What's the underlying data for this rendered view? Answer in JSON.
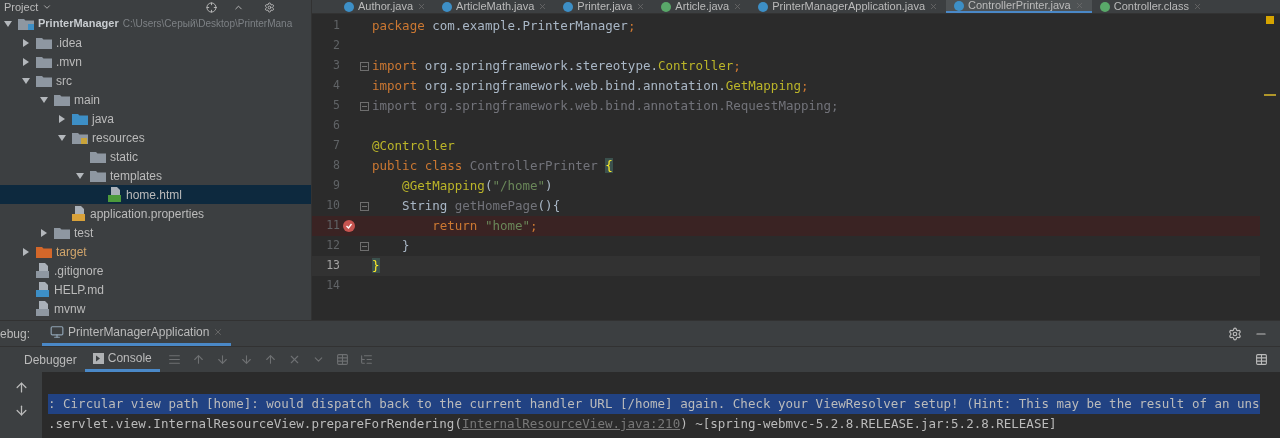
{
  "project_panel": {
    "title": "Project",
    "tree": [
      {
        "label": "PrinterManager",
        "path": "C:\\Users\\Серый\\Desktop\\PrinterMana",
        "kind": "module",
        "expanded": true,
        "selected": false,
        "children": [
          {
            "label": ".idea",
            "kind": "folder",
            "expanded": false,
            "selected": false
          },
          {
            "label": ".mvn",
            "kind": "folder",
            "expanded": false,
            "selected": false
          },
          {
            "label": "src",
            "kind": "folder",
            "expanded": true,
            "selected": false,
            "children": [
              {
                "label": "main",
                "kind": "folder",
                "expanded": true,
                "selected": false,
                "children": [
                  {
                    "label": "java",
                    "kind": "source",
                    "expanded": false,
                    "selected": false
                  },
                  {
                    "label": "resources",
                    "kind": "resources",
                    "expanded": true,
                    "selected": false,
                    "children": [
                      {
                        "label": "static",
                        "kind": "folder",
                        "selected": false
                      },
                      {
                        "label": "templates",
                        "kind": "folder",
                        "expanded": true,
                        "selected": false,
                        "children": [
                          {
                            "label": "home.html",
                            "kind": "html",
                            "selected": true
                          }
                        ]
                      }
                    ]
                  },
                  {
                    "label": "application.properties",
                    "kind": "properties",
                    "selected": false
                  }
                ]
              },
              {
                "label": "test",
                "kind": "folder",
                "expanded": false,
                "selected": false
              }
            ]
          },
          {
            "label": "target",
            "kind": "excluded",
            "expanded": false,
            "selected": false
          },
          {
            "label": ".gitignore",
            "kind": "ignore",
            "selected": false
          },
          {
            "label": "HELP.md",
            "kind": "markdown",
            "selected": false
          },
          {
            "label": "mvnw",
            "kind": "script",
            "selected": false
          }
        ]
      }
    ]
  },
  "editor_tabs": [
    {
      "label": "Author.java",
      "kind": "class",
      "selected": false
    },
    {
      "label": "ArticleMath.java",
      "kind": "class",
      "selected": false
    },
    {
      "label": "Printer.java",
      "kind": "class",
      "selected": false
    },
    {
      "label": "Article.java",
      "kind": "interface",
      "selected": false
    },
    {
      "label": "PrinterManagerApplication.java",
      "kind": "class",
      "selected": false
    },
    {
      "label": "ControllerPrinter.java",
      "kind": "class",
      "selected": true
    },
    {
      "label": "Controller.class",
      "kind": "interface",
      "selected": false
    }
  ],
  "code": {
    "lines": [
      {
        "number": "1",
        "fold": false,
        "breakpoint": false,
        "current": false,
        "tokens": [
          {
            "text": "package",
            "kind": "keyword"
          },
          {
            "text": " com.example.PrinterManager",
            "kind": "plain"
          },
          {
            "text": ";",
            "kind": "keyword"
          }
        ]
      },
      {
        "number": "2",
        "fold": false,
        "breakpoint": false,
        "current": false
      },
      {
        "number": "3",
        "fold": true,
        "breakpoint": false,
        "current": false,
        "tokens": [
          {
            "text": "import",
            "kind": "keyword"
          },
          {
            "text": " org.springframework.stereotype.",
            "kind": "plain"
          },
          {
            "text": "Controller",
            "kind": "annotation"
          },
          {
            "text": ";",
            "kind": "keyword"
          }
        ]
      },
      {
        "number": "4",
        "fold": false,
        "breakpoint": false,
        "current": false,
        "tokens": [
          {
            "text": "import",
            "kind": "keyword"
          },
          {
            "text": " org.springframework.web.bind.annotation.",
            "kind": "plain"
          },
          {
            "text": "GetMapping",
            "kind": "annotation"
          },
          {
            "text": ";",
            "kind": "keyword"
          }
        ]
      },
      {
        "number": "5",
        "fold": true,
        "breakpoint": false,
        "current": false,
        "tokens": [
          {
            "text": "import org.springframework.web.bind.annotation.RequestMapping;",
            "kind": "unused"
          }
        ]
      },
      {
        "number": "6",
        "fold": false,
        "breakpoint": false,
        "current": false
      },
      {
        "number": "7",
        "fold": false,
        "breakpoint": false,
        "current": false,
        "tokens": [
          {
            "text": "@Controller",
            "kind": "annotation"
          }
        ]
      },
      {
        "number": "8",
        "fold": false,
        "breakpoint": false,
        "current": false,
        "tokens": [
          {
            "text": "public class",
            "kind": "keyword"
          },
          {
            "text": " ControllerPrinter ",
            "kind": "unused"
          },
          {
            "text": "{",
            "kind": "brace"
          }
        ]
      },
      {
        "number": "9",
        "fold": false,
        "breakpoint": false,
        "current": false,
        "tokens": [
          {
            "text": "    @GetMapping",
            "kind": "annotation"
          },
          {
            "text": "(",
            "kind": "plain"
          },
          {
            "text": "\"/home\"",
            "kind": "string"
          },
          {
            "text": ")",
            "kind": "plain"
          }
        ]
      },
      {
        "number": "10",
        "fold": true,
        "breakpoint": false,
        "current": false,
        "tokens": [
          {
            "text": "    String",
            "kind": "plain"
          },
          {
            "text": " getHomePage",
            "kind": "unused"
          },
          {
            "text": "(){",
            "kind": "plain"
          }
        ]
      },
      {
        "number": "11",
        "fold": false,
        "breakpoint": true,
        "current": false,
        "tokens": [
          {
            "text": "        return",
            "kind": "keyword"
          },
          {
            "text": " \"home\"",
            "kind": "string"
          },
          {
            "text": ";",
            "kind": "keyword"
          }
        ]
      },
      {
        "number": "12",
        "fold": true,
        "breakpoint": false,
        "current": false,
        "tokens": [
          {
            "text": "    }",
            "kind": "plain"
          }
        ]
      },
      {
        "number": "13",
        "fold": false,
        "breakpoint": false,
        "current": true,
        "tokens": [
          {
            "text": "}",
            "kind": "brace"
          }
        ]
      },
      {
        "number": "14",
        "fold": false,
        "breakpoint": false,
        "current": false
      }
    ]
  },
  "debug_panel": {
    "title": "ebug:",
    "session_tab": {
      "label": "PrinterManagerApplication",
      "selected": true
    },
    "tabs": [
      {
        "label": "Debugger",
        "selected": false
      },
      {
        "label": "Console",
        "selected": true
      }
    ],
    "console_lines": [
      {
        "selected": true,
        "parts": [
          {
            "text": ": Circular view path [home]: would dispatch back to the current handler URL [/home] again. Check your ViewResolver setup! (Hint: This may be the result of an uns",
            "kind": "plain"
          }
        ]
      },
      {
        "selected": false,
        "parts": [
          {
            "text": ".servlet.view.InternalResourceView.prepareForRendering(",
            "kind": "plain"
          },
          {
            "text": "InternalResourceView.java:210",
            "kind": "link"
          },
          {
            "text": ") ~[spring-webmvc-5.2.8.RELEASE.jar:5.2.8.RELEASE]",
            "kind": "plain"
          }
        ]
      }
    ]
  }
}
